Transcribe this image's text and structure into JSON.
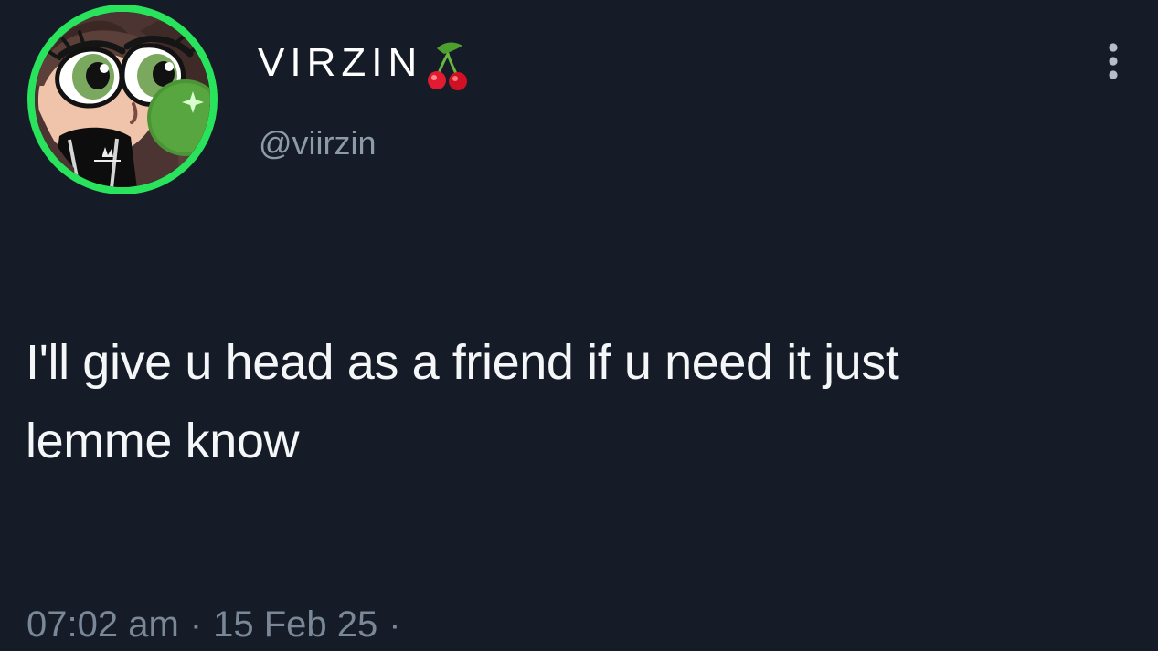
{
  "user": {
    "display_name": "VIRZIN",
    "handle": "@viirzin",
    "avatar_icon": "cartoon-avatar-icon",
    "emoji_icon": "cherry-icon"
  },
  "tweet": {
    "lines": [
      "I'll give u head as a friend if u need it just",
      "lemme know"
    ]
  },
  "meta": {
    "time": "07:02 am",
    "separator": "·",
    "date": "15 Feb 25",
    "trailing_separator": "·"
  },
  "actions": {
    "more_icon": "more-vertical-icon"
  },
  "colors": {
    "background": "#151c27",
    "text": "#f4f6f8",
    "secondary_text": "#8d9aa8",
    "timestamp_text": "#798797",
    "avatar_ring": "#28e35b",
    "cherry_red": "#e31b32",
    "cherry_leaf": "#4d9f2e"
  }
}
